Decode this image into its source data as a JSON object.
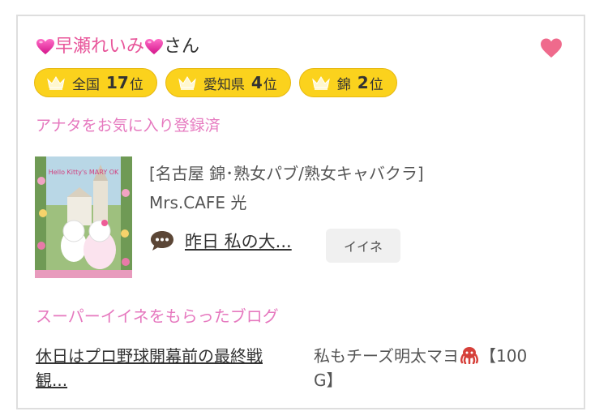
{
  "profile": {
    "name": "早瀬れいみ",
    "suffix": "さん",
    "name_icon": "pink-heart-icon"
  },
  "favorite_icon": "heart-icon",
  "colors": {
    "accent_pink": "#e8559a",
    "rank_yellow": "#fbd21d",
    "fav_heart": "#ef6a8c"
  },
  "ranks": [
    {
      "label": "全国",
      "num": "17",
      "unit": "位",
      "icon": "crown-icon"
    },
    {
      "label": "愛知県",
      "num": "4",
      "unit": "位",
      "icon": "crown-icon"
    },
    {
      "label": "錦",
      "num": "2",
      "unit": "位",
      "icon": "crown-icon"
    }
  ],
  "favorite_status": "アナタをお気に入り登録済",
  "shop": {
    "category": "[名古屋 錦･熟女パブ/熟女キャバクラ]",
    "name": "Mrs.CAFE 光",
    "thumb_text": "Hello Kitty's MARY OK"
  },
  "message": {
    "icon": "speech-bubble-icon",
    "text": "昨日 私の大...",
    "iine_label": "イイネ"
  },
  "blog": {
    "heading": "スーパーイイネをもらったブログ",
    "title_line1": "休日はプロ野球開幕前の最終戦",
    "title_line2": "観...",
    "desc_part1": "私もチーズ明太マヨ",
    "desc_icon": "octopus-icon",
    "desc_part2": "【100",
    "desc_line2": "G】"
  }
}
